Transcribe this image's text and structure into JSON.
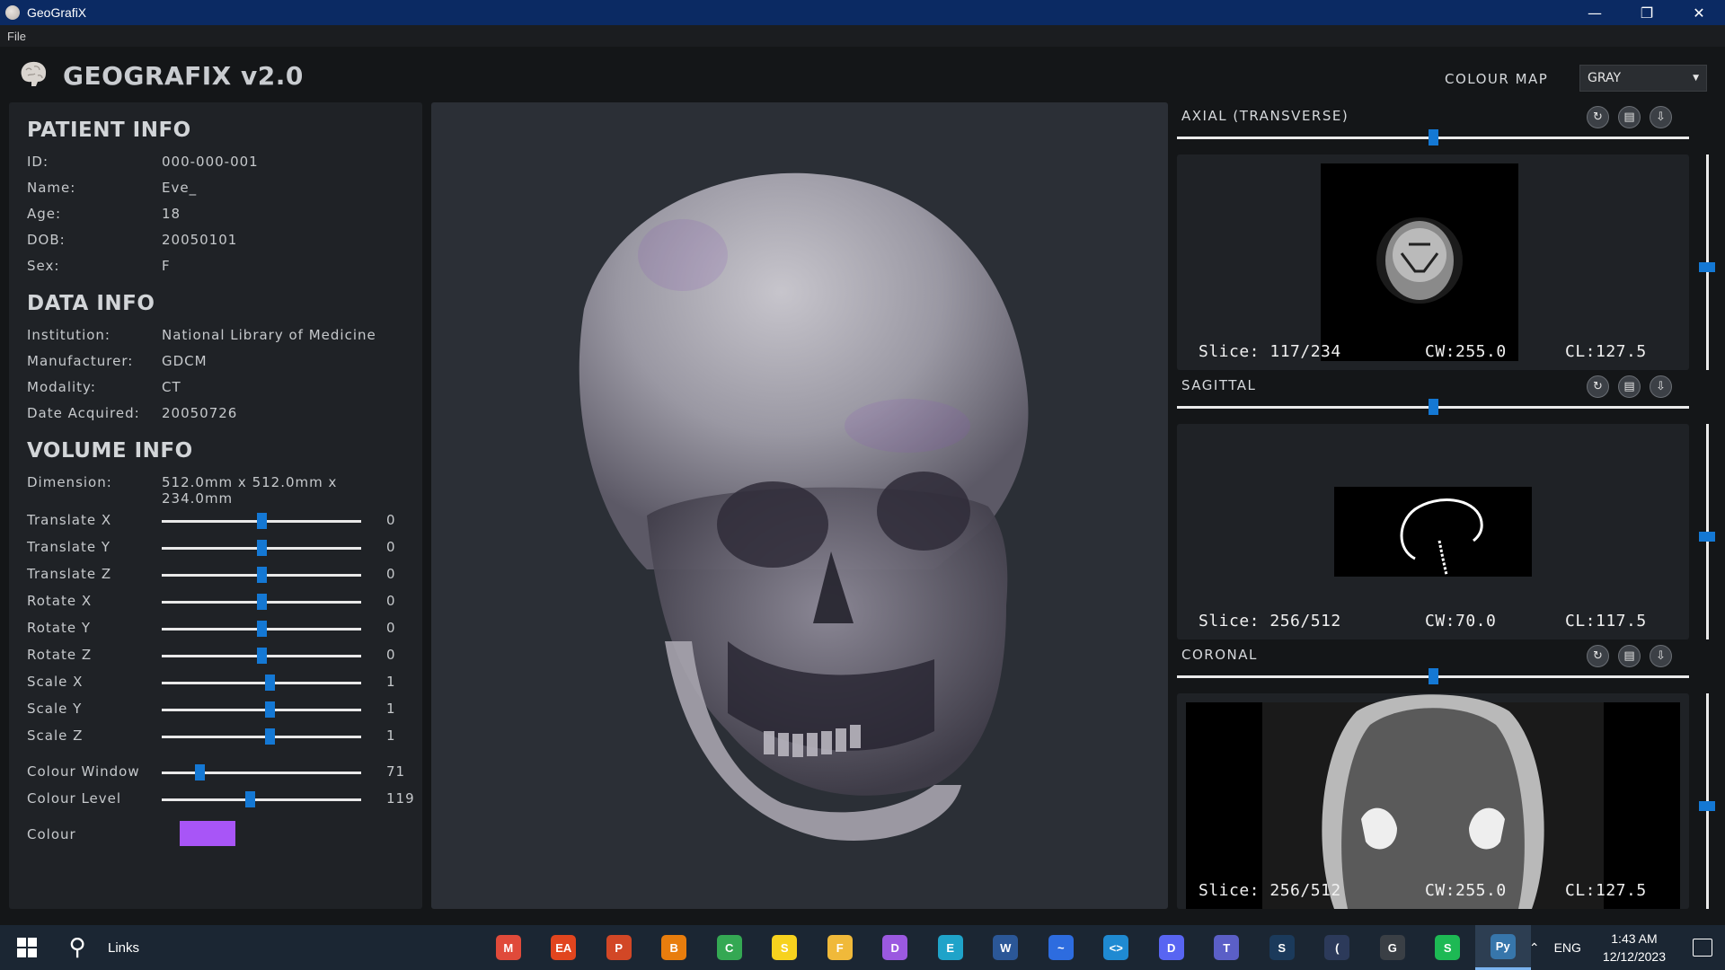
{
  "window": {
    "title": "GeoGrafiX"
  },
  "menu": {
    "file": "File"
  },
  "header": {
    "title": "GEOGRAFIX v2.0",
    "colour_map_label": "COLOUR MAP",
    "colour_map_value": "GRAY"
  },
  "patient_info": {
    "title": "PATIENT INFO",
    "rows": [
      {
        "label": "ID:",
        "value": "000-000-001"
      },
      {
        "label": "Name:",
        "value": "Eve_"
      },
      {
        "label": "Age:",
        "value": "18"
      },
      {
        "label": "DOB:",
        "value": "20050101"
      },
      {
        "label": "Sex:",
        "value": "F"
      }
    ]
  },
  "data_info": {
    "title": "DATA INFO",
    "rows": [
      {
        "label": "Institution:",
        "value": "National Library of Medicine"
      },
      {
        "label": "Manufacturer:",
        "value": "GDCM"
      },
      {
        "label": "Modality:",
        "value": "CT"
      },
      {
        "label": "Date Acquired:",
        "value": "20050726"
      }
    ]
  },
  "volume_info": {
    "title": "VOLUME INFO",
    "dimension_label": "Dimension:",
    "dimension_value": "512.0mm x 512.0mm x 234.0mm",
    "sliders": [
      {
        "label": "Translate X",
        "value": "0",
        "fraction": 0.5
      },
      {
        "label": "Translate Y",
        "value": "0",
        "fraction": 0.5
      },
      {
        "label": "Translate Z",
        "value": "0",
        "fraction": 0.5
      },
      {
        "label": "Rotate X",
        "value": "0",
        "fraction": 0.5
      },
      {
        "label": "Rotate Y",
        "value": "0",
        "fraction": 0.5
      },
      {
        "label": "Rotate Z",
        "value": "0",
        "fraction": 0.5
      },
      {
        "label": "Scale X",
        "value": "1",
        "fraction": 0.54
      },
      {
        "label": "Scale Y",
        "value": "1",
        "fraction": 0.54
      },
      {
        "label": "Scale Z",
        "value": "1",
        "fraction": 0.54
      }
    ],
    "colour_sliders": [
      {
        "label": "Colour Window",
        "value": "71",
        "fraction": 0.19
      },
      {
        "label": "Colour Level",
        "value": "119",
        "fraction": 0.44
      }
    ],
    "colour_label": "Colour",
    "colour_value": "#a855f7"
  },
  "views": [
    {
      "title": "AXIAL (TRANSVERSE)",
      "slider_fraction": 0.5,
      "v_slider_fraction": 0.5,
      "slice": "Slice: 117/234",
      "cw": "CW:255.0",
      "cl": "CL:127.5"
    },
    {
      "title": "SAGITTAL",
      "slider_fraction": 0.5,
      "v_slider_fraction": 0.5,
      "slice": "Slice: 256/512",
      "cw": "CW:70.0",
      "cl": "CL:117.5"
    },
    {
      "title": "CORONAL",
      "slider_fraction": 0.5,
      "v_slider_fraction": 0.5,
      "slice": "Slice: 256/512",
      "cw": "CW:255.0",
      "cl": "CL:127.5"
    }
  ],
  "taskbar": {
    "search_label": "Links",
    "apps": [
      {
        "name": "mail",
        "glyph": "M",
        "color": "#e04a3a"
      },
      {
        "name": "ea",
        "glyph": "EA",
        "color": "#e1451e"
      },
      {
        "name": "powerpoint",
        "glyph": "P",
        "color": "#d24726"
      },
      {
        "name": "blender",
        "glyph": "B",
        "color": "#e87d0d"
      },
      {
        "name": "chrome",
        "glyph": "C",
        "color": "#34a853"
      },
      {
        "name": "sticky-notes",
        "glyph": "S",
        "color": "#f7d21e"
      },
      {
        "name": "file-explorer",
        "glyph": "F",
        "color": "#f0b93a"
      },
      {
        "name": "paint",
        "glyph": "D",
        "color": "#9b59e0"
      },
      {
        "name": "edge",
        "glyph": "E",
        "color": "#1fa3c9"
      },
      {
        "name": "word",
        "glyph": "W",
        "color": "#2b5797"
      },
      {
        "name": "whiteboard",
        "glyph": "~",
        "color": "#2d6cdf"
      },
      {
        "name": "vscode",
        "glyph": "<>",
        "color": "#1f8ad2"
      },
      {
        "name": "discord",
        "glyph": "D",
        "color": "#5865f2"
      },
      {
        "name": "teams",
        "glyph": "T",
        "color": "#5b5fc7"
      },
      {
        "name": "steam",
        "glyph": "S",
        "color": "#1b3a5b"
      },
      {
        "name": "eclipse",
        "glyph": "(",
        "color": "#2c3a5a"
      },
      {
        "name": "game-controller",
        "glyph": "G",
        "color": "#3a3f45"
      },
      {
        "name": "spotify",
        "glyph": "S",
        "color": "#1db954"
      },
      {
        "name": "python-app",
        "glyph": "Py",
        "color": "#3776ab"
      }
    ],
    "lang": "ENG",
    "time": "1:43 AM",
    "date": "12/12/2023"
  }
}
